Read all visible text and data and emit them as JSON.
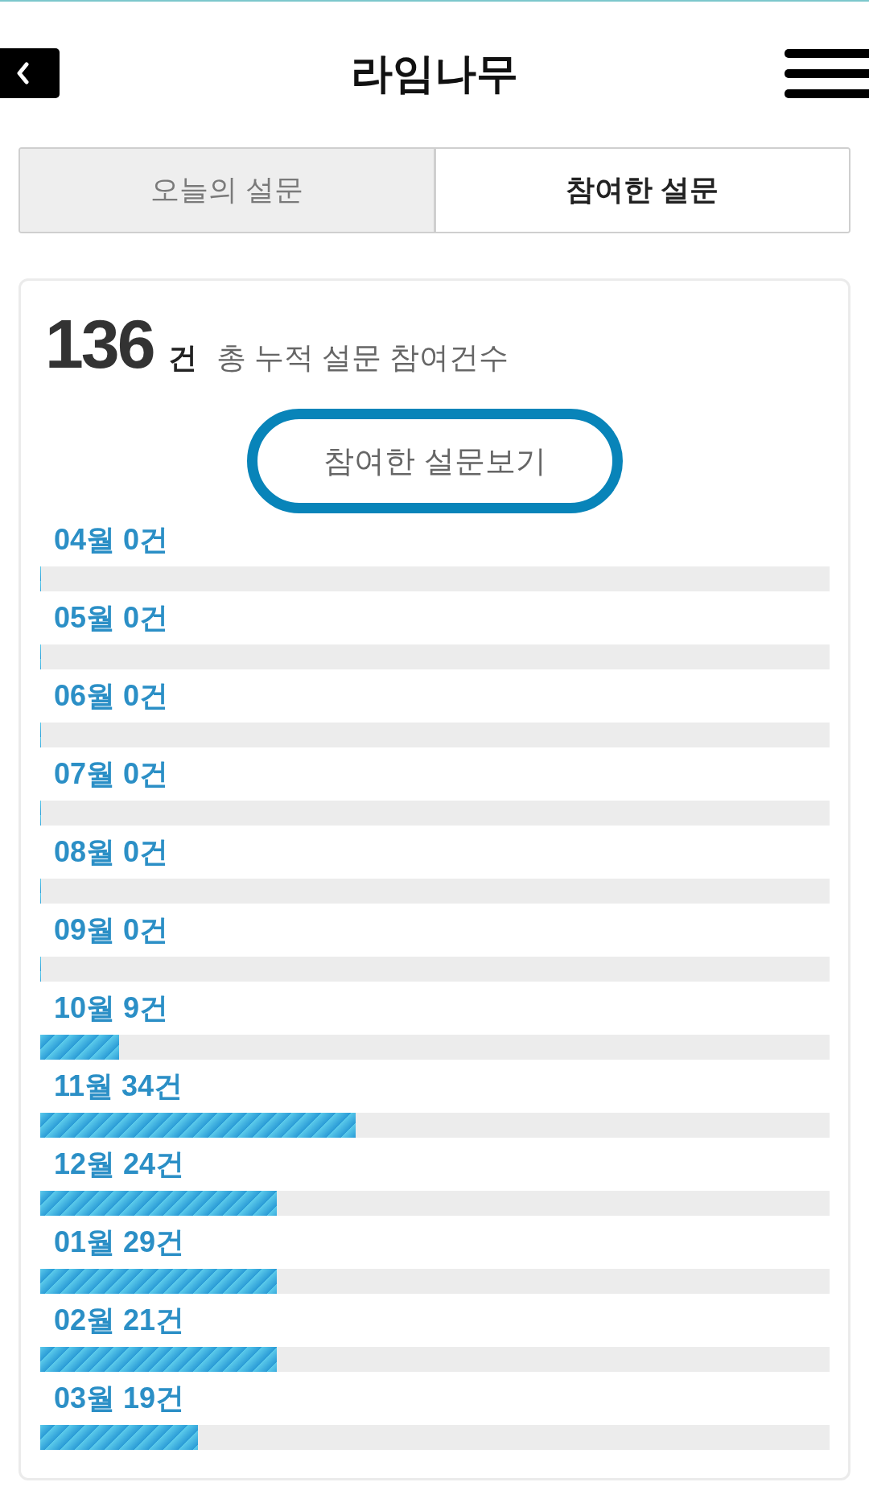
{
  "header": {
    "title": "라임나무"
  },
  "tabs": [
    {
      "label": "오늘의 설문",
      "selected": false
    },
    {
      "label": "참여한 설문",
      "selected": true
    }
  ],
  "summary": {
    "count": "136",
    "unit": "건",
    "description": "총 누적 설문 참여건수"
  },
  "view_button": {
    "label": "참여한 설문보기"
  },
  "months": [
    {
      "label": "04월 0건",
      "level": 0
    },
    {
      "label": "05월 0건",
      "level": 0
    },
    {
      "label": "06월 0건",
      "level": 0
    },
    {
      "label": "07월 0건",
      "level": 0
    },
    {
      "label": "08월 0건",
      "level": 0
    },
    {
      "label": "09월 0건",
      "level": 0
    },
    {
      "label": "10월 9건",
      "level": 0.1
    },
    {
      "label": "11월 34건",
      "level": 0.4
    },
    {
      "label": "12월 24건",
      "level": 0.3
    },
    {
      "label": "01월 29건",
      "level": 0.3
    },
    {
      "label": "02월 21건",
      "level": 0.3
    },
    {
      "label": "03월 19건",
      "level": 0.2
    }
  ]
}
